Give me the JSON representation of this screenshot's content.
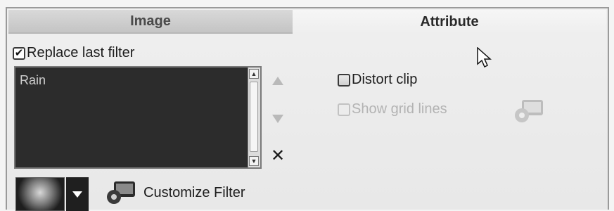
{
  "tabs": {
    "image_label": "Image",
    "attribute_label": "Attribute"
  },
  "replace_last_filter": {
    "label": "Replace last filter",
    "checked": true
  },
  "filter_list": {
    "items": [
      "Rain"
    ]
  },
  "distort_clip": {
    "label": "Distort clip",
    "checked": false
  },
  "show_grid_lines": {
    "label": "Show grid lines",
    "checked": false,
    "enabled": false
  },
  "customize_filter": {
    "label": "Customize Filter"
  },
  "icons": {
    "move_up": "up-arrow-icon",
    "move_down": "down-arrow-icon",
    "remove": "remove-x-icon",
    "preset": "filter-preset-thumbnail",
    "dropdown": "chevron-down-icon",
    "customize": "gear-monitor-icon",
    "grid_settings": "gear-monitor-icon",
    "cursor": "mouse-pointer-icon"
  }
}
